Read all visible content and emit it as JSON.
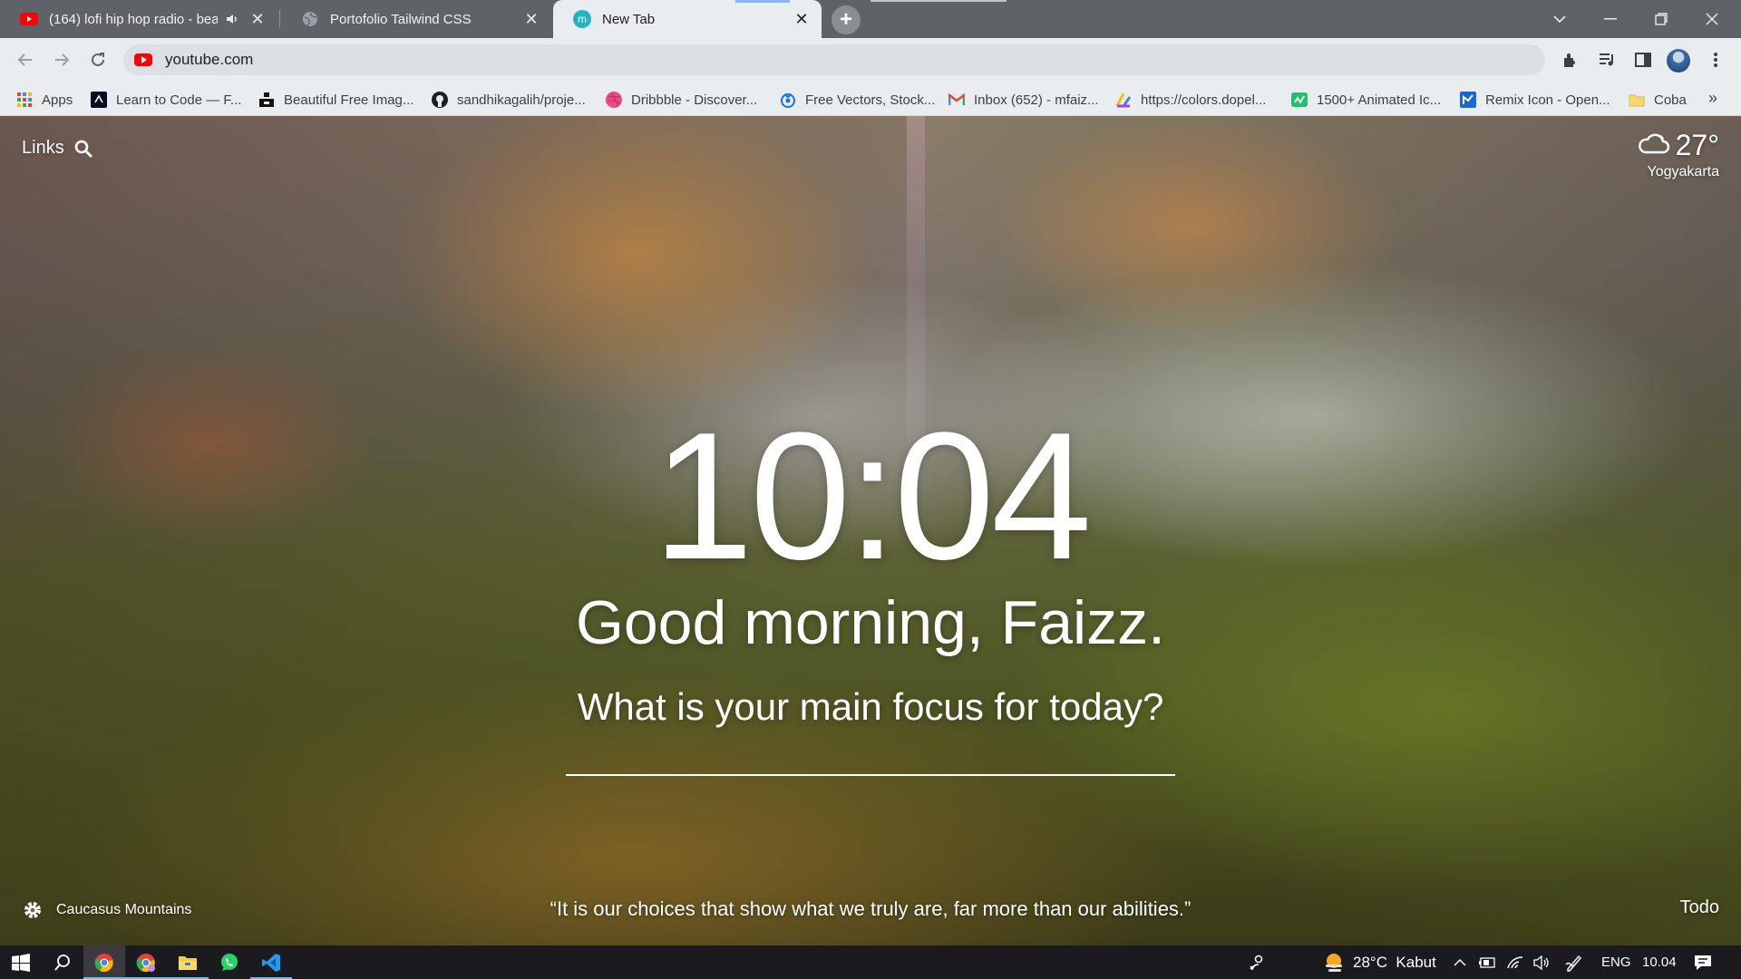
{
  "browser": {
    "tabs": [
      {
        "title": "(164) lofi hip hop radio - bea",
        "favicon": "youtube-icon",
        "audio": true
      },
      {
        "title": "Portofolio Tailwind CSS",
        "favicon": "globe-icon"
      },
      {
        "title": "New Tab",
        "favicon": "momentum-icon",
        "favicon_letter": "m",
        "active": true
      }
    ],
    "address": {
      "url": "youtube.com"
    },
    "bookmarks": [
      {
        "label": "Apps",
        "icon": "apps-grid-icon"
      },
      {
        "label": "Learn to Code — F...",
        "icon": "freecodecamp-icon"
      },
      {
        "label": "Beautiful Free Imag...",
        "icon": "unsplash-icon"
      },
      {
        "label": "sandhikagalih/proje...",
        "icon": "github-icon"
      },
      {
        "label": "Dribbble - Discover...",
        "icon": "dribbble-icon"
      },
      {
        "label": "Free Vectors, Stock...",
        "icon": "freepik-icon"
      },
      {
        "label": "Inbox (652) - mfaiz...",
        "icon": "gmail-icon"
      },
      {
        "label": "https://colors.dopel...",
        "icon": "colors-icon"
      },
      {
        "label": "1500+ Animated Ic...",
        "icon": "animated-icons-icon"
      },
      {
        "label": "Remix Icon - Open...",
        "icon": "remix-icon"
      },
      {
        "label": "Coba",
        "icon": "folder-icon"
      }
    ],
    "bookmarks_overflow": "»"
  },
  "newtab": {
    "links_label": "Links",
    "weather": {
      "temp": "27°",
      "location": "Yogyakarta",
      "icon": "cloud-icon"
    },
    "time": "10:04",
    "greeting": "Good morning, Faizz.",
    "focus_question": "What is your main focus for today?",
    "focus_value": "",
    "background_location": "Caucasus Mountains",
    "quote": "“It is our choices that show what we truly are, far more than our abilities.”",
    "todo_label": "Todo"
  },
  "taskbar": {
    "apps": [
      "windows-start-icon",
      "search-icon",
      "chrome-icon",
      "chrome-profile-icon",
      "file-explorer-icon",
      "whatsapp-icon",
      "vscode-icon"
    ],
    "weather_text": "28°C  Kabut",
    "language": "ENG",
    "clock": "10.04"
  },
  "colors": {
    "tabstrip": "#5f6368",
    "toolbar": "#eaedf0",
    "taskbar": "#1b1b1f",
    "accent": "#76b9ed"
  }
}
